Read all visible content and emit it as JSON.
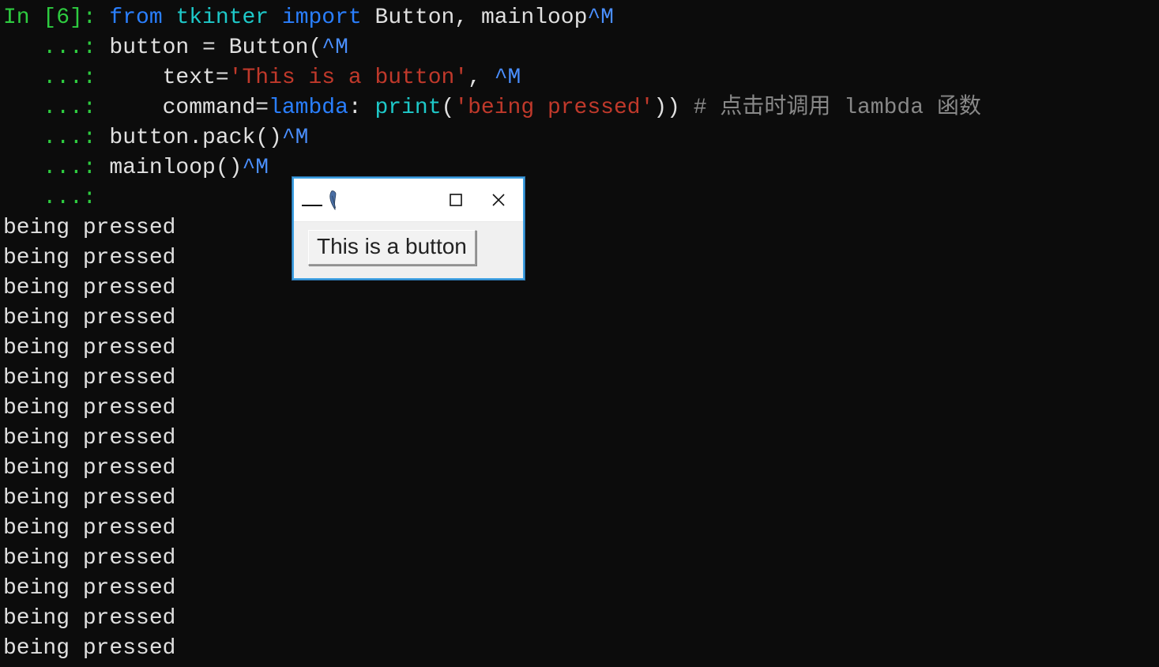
{
  "terminal": {
    "prompt": "In [6]: ",
    "cont": "   ...: ",
    "code": {
      "l1_from": "from",
      "l1_mod": "tkinter",
      "l1_import": "import",
      "l1_names": "Button, mainloop",
      "l1_cm": "^M",
      "l2_plain": "button = Button(",
      "l2_cm": "^M",
      "l3_lead": "    text=",
      "l3_str": "'This is a button'",
      "l3_tail": ", ",
      "l3_cm": "^M",
      "l4_lead": "    command=",
      "l4_lambda": "lambda",
      "l4_colon": ": ",
      "l4_print": "print",
      "l4_open": "(",
      "l4_str": "'being pressed'",
      "l4_close": ")) ",
      "l4_comment": "# 点击时调用 lambda 函数",
      "l5_plain": "button.pack()",
      "l5_cm": "^M",
      "l6_plain": "mainloop()",
      "l6_cm": "^M"
    },
    "output_line": "being pressed",
    "output_repeat": 15
  },
  "tk": {
    "button_text": "This is a button"
  }
}
